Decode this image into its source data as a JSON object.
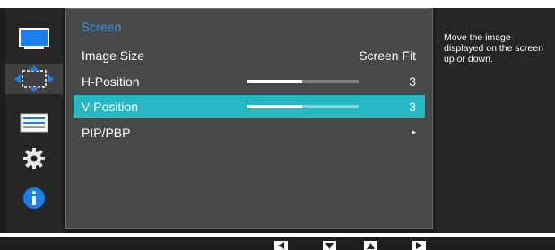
{
  "menu": {
    "title": "Screen",
    "items": [
      {
        "label": "Image Size",
        "value": "Screen Fit"
      },
      {
        "label": "H-Position",
        "value": "3",
        "level": 0.49
      },
      {
        "label": "V-Position",
        "value": "3",
        "level": 0.49,
        "selected": true
      },
      {
        "label": "PIP/PBP",
        "value": "▸"
      }
    ]
  },
  "help": {
    "text": "Move the image displayed on the screen up or down."
  },
  "sidebar": {
    "icons": [
      "monitor-icon",
      "position-arrows-icon",
      "settings-bars-icon",
      "gear-icon",
      "info-icon"
    ]
  },
  "navbar": {
    "buttons": [
      "left-arrow-button",
      "down-arrow-button",
      "up-arrow-button",
      "right-arrow-button"
    ]
  },
  "colors": {
    "accent_title": "#3d8df5",
    "selected_row": "#26b9c3",
    "info_icon": "#1a7ef0",
    "monitor_icon": "#1a7ef0"
  }
}
